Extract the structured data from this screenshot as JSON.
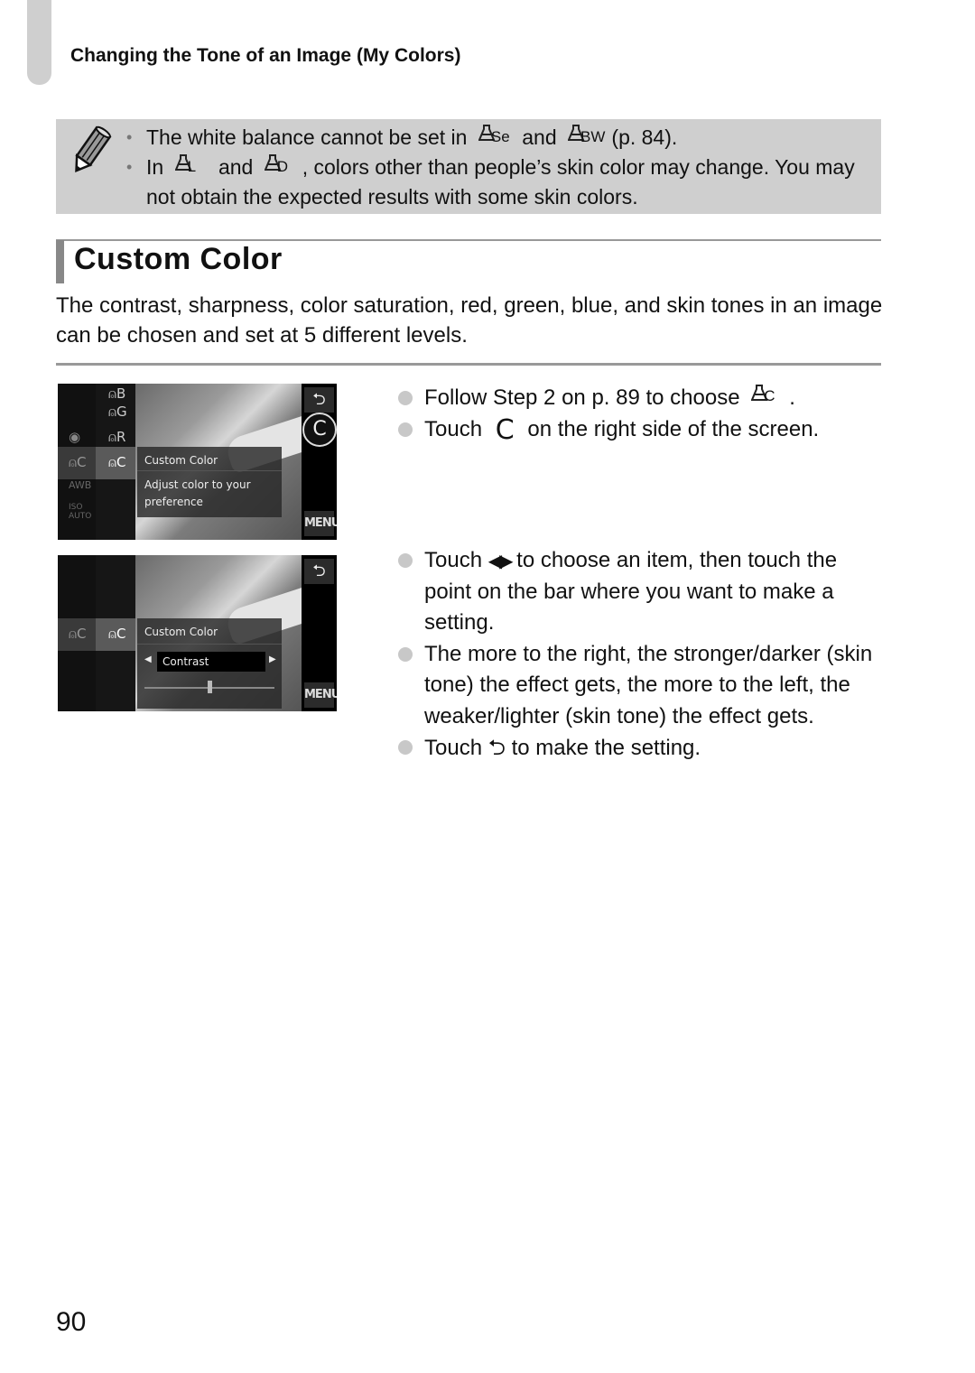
{
  "header": {
    "running_title": "Changing the Tone of an Image (My Colors)"
  },
  "note": {
    "icon": "pencil-icon",
    "items": [
      {
        "parts": [
          "The white balance cannot be set in",
          "and",
          "(p. 84)."
        ],
        "icons": [
          {
            "name": "sepia-mode-icon",
            "sub": "Se"
          },
          {
            "name": "bw-mode-icon",
            "sub": "BW"
          }
        ]
      },
      {
        "parts": [
          "In",
          "and",
          ", colors other than people’s skin color may change. You may not obtain the expected results with some skin colors."
        ],
        "icons": [
          {
            "name": "lighter-skin-mode-icon",
            "sub": "L"
          },
          {
            "name": "darker-skin-mode-icon",
            "sub": "D"
          }
        ]
      }
    ]
  },
  "section": {
    "title": "Custom Color",
    "intro": "The contrast, sharpness, color saturation, red, green, blue, and skin tones in an image can be chosen and set at 5 different levels."
  },
  "screens": [
    {
      "left_column_icons": [
        "camera-mode",
        "custom-color",
        "awb",
        "iso-auto"
      ],
      "menu_icons": [
        {
          "sub": "B"
        },
        {
          "sub": "G"
        },
        {
          "sub": "R"
        },
        {
          "sub": "C"
        }
      ],
      "selected_icon_sub": "C",
      "overlay_title": "Custom Color",
      "overlay_desc": "Adjust color to your preference",
      "back_glyph": "⮌",
      "c_button": "C",
      "menu_label": "MENU"
    },
    {
      "selected_icon_sub": "C",
      "overlay_title": "Custom Color",
      "item_label": "Contrast",
      "slider_level": 0.5,
      "back_glyph": "⮌",
      "menu_label": "MENU"
    }
  ],
  "steps_group1": [
    {
      "before": "Follow Step 2 on p. 89 to choose",
      "icon_sub": "C",
      "after": "."
    },
    {
      "before": "Touch",
      "glyph": "C",
      "after": "on the right side of the screen."
    }
  ],
  "steps_group2": [
    {
      "before": "Touch",
      "glyph": "◀▶",
      "after": "to choose an item, then touch the point on the bar where you want to make a setting."
    },
    {
      "text": "The more to the right, the stronger/darker (skin tone) the effect gets, the more to the left, the weaker/lighter (skin tone) the effect gets."
    },
    {
      "before": "Touch",
      "glyph": "⮌",
      "after": "to make the setting."
    }
  ],
  "footer": {
    "page_number": "90"
  }
}
